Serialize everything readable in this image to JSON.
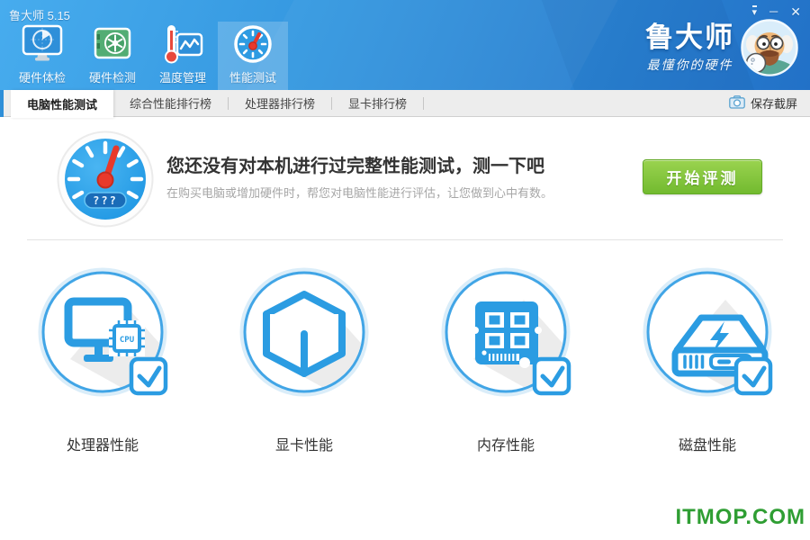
{
  "window": {
    "title": "鲁大师 5.15"
  },
  "header": {
    "nav": [
      {
        "label": "硬件体检",
        "icon": "monitor-radar-icon",
        "selected": false
      },
      {
        "label": "硬件检测",
        "icon": "gpu-card-icon",
        "selected": false
      },
      {
        "label": "温度管理",
        "icon": "thermometer-chart-icon",
        "selected": false
      },
      {
        "label": "性能测试",
        "icon": "speedometer-icon",
        "selected": true
      }
    ],
    "brand": {
      "logo": "鲁大师",
      "tagline": "最懂你的硬件"
    },
    "window_controls": [
      {
        "name": "menu-dropdown-icon",
        "glyph": "▾"
      },
      {
        "name": "minimize-icon",
        "glyph": "─"
      },
      {
        "name": "close-icon",
        "glyph": "✕"
      }
    ]
  },
  "tabbar": {
    "tabs": [
      {
        "label": "电脑性能测试",
        "active": true
      },
      {
        "label": "综合性能排行榜",
        "active": false
      },
      {
        "label": "处理器排行榜",
        "active": false
      },
      {
        "label": "显卡排行榜",
        "active": false
      }
    ],
    "save_screenshot": {
      "label": "保存截屏",
      "icon": "camera-icon"
    }
  },
  "banner": {
    "gauge": {
      "icon": "speedometer-gauge-icon",
      "badge": "???"
    },
    "title": "您还没有对本机进行过完整性能测试，测一下吧",
    "subtitle": "在购买电脑或增加硬件时，帮您对电脑性能进行评估，让您做到心中有数。",
    "start_button": "开始评测"
  },
  "tests": {
    "items": [
      {
        "label": "处理器性能",
        "icon": "cpu-monitor-icon",
        "chip_label": "CPU",
        "checked": true
      },
      {
        "label": "显卡性能",
        "icon": "gpu-cube-icon",
        "checked": true
      },
      {
        "label": "内存性能",
        "icon": "memory-module-icon",
        "checked": true
      },
      {
        "label": "磁盘性能",
        "icon": "disk-drive-icon",
        "checked": true
      }
    ]
  },
  "watermark": "ITMOP.COM",
  "colors": {
    "header_blue_light": "#47acee",
    "header_blue_dark": "#2271c7",
    "accent_blue": "#2b9ce2",
    "tabbar_gray": "#ededed",
    "button_green_top": "#9ad34f",
    "button_green_bottom": "#72ba2f",
    "watermark_green": "#2f9e33",
    "needle_red": "#e8392b"
  }
}
